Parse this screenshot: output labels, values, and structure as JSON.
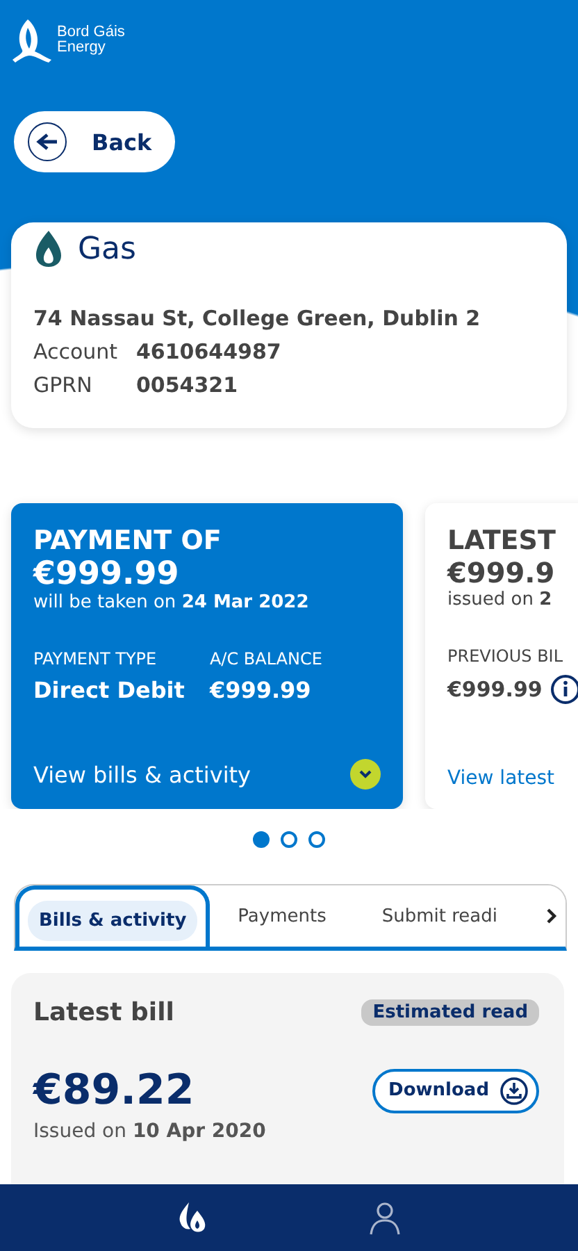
{
  "brand": {
    "line_1": "Bord Gáis",
    "line_2": "Energy"
  },
  "back_button": {
    "label": "Back"
  },
  "account_card": {
    "title": "Gas",
    "address": "74 Nassau St, College Green, Dublin 2",
    "fields": [
      {
        "label": "Account",
        "value": "4610644987"
      },
      {
        "label": "GPRN",
        "value": "0054321"
      }
    ]
  },
  "summary_cards": [
    {
      "kind": "payment",
      "heading": "PAYMENT OF",
      "amount": "€999.99",
      "note": "will be taken on",
      "date": "24 Mar 2022",
      "details": [
        {
          "label": "PAYMENT TYPE",
          "value": "Direct Debit"
        },
        {
          "label": "A/C BALANCE",
          "value": "€999.99"
        }
      ],
      "link": "View bills & activity"
    },
    {
      "kind": "bill",
      "heading": "LATEST",
      "amount": "€999.9",
      "note": "issued on",
      "date": "2",
      "details": [
        {
          "label": "PREVIOUS BIL",
          "value": "€999.99"
        }
      ],
      "link": "View latest"
    }
  ],
  "pager": [
    {
      "selected": true
    },
    {
      "selected": false
    },
    {
      "selected": false
    }
  ],
  "tabs": [
    {
      "label": "Bills & activity",
      "selected": true
    },
    {
      "label": "Payments",
      "selected": false
    },
    {
      "label": "Submit readi",
      "selected": false
    }
  ],
  "latest_bill": {
    "title": "Latest bill",
    "badge": "Estimated read",
    "amount": "€89.22",
    "issued_label": "Issued on",
    "issued_date": "10 Apr 2020",
    "download": "Download"
  },
  "bottom_nav": [
    {
      "kind": "energy",
      "selected": true
    },
    {
      "kind": "profile",
      "selected": false
    }
  ]
}
